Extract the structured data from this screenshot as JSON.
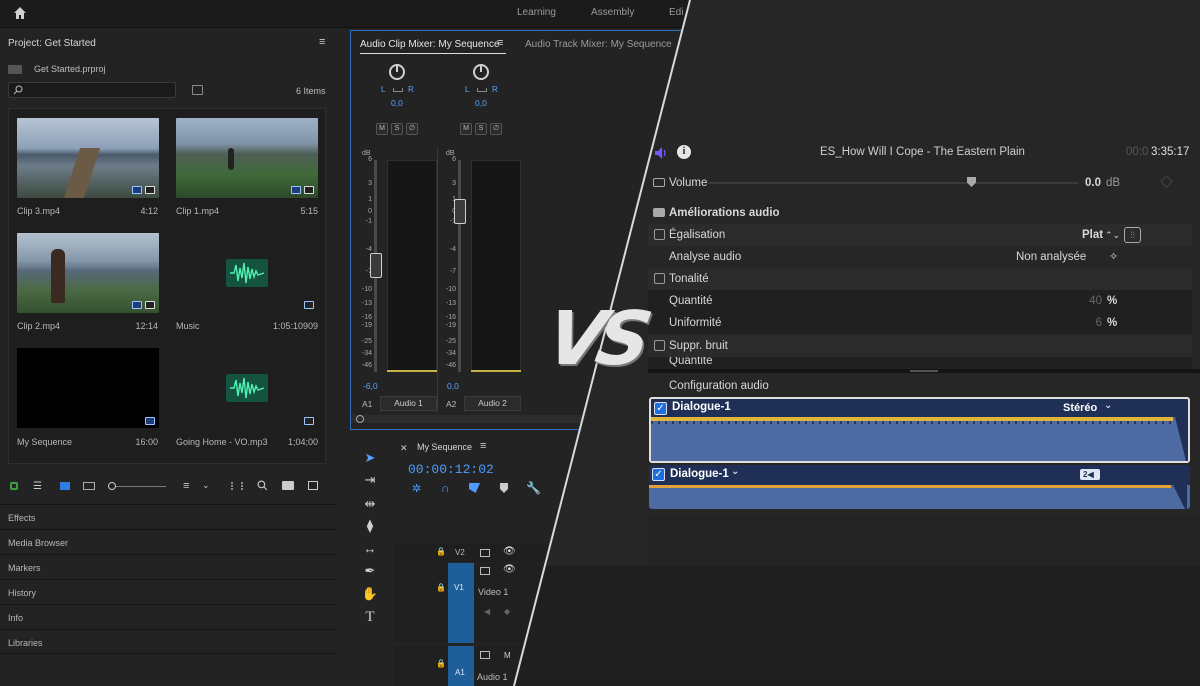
{
  "premiere": {
    "workspaces": [
      "Learning",
      "Assembly",
      "Edi"
    ],
    "project": {
      "title": "Project: Get Started",
      "file": "Get Started.prproj",
      "item_count": "6 Items",
      "search_placeholder": "",
      "items": [
        {
          "name": "Clip 3.mp4",
          "duration": "4:12",
          "kind": "video"
        },
        {
          "name": "Clip 1.mp4",
          "duration": "5:15",
          "kind": "video"
        },
        {
          "name": "Clip 2.mp4",
          "duration": "12:14",
          "kind": "video"
        },
        {
          "name": "Music",
          "duration": "1:05:10909",
          "kind": "audio"
        },
        {
          "name": "My Sequence",
          "duration": "16:00",
          "kind": "sequence"
        },
        {
          "name": "Going Home - VO.mp3",
          "duration": "1;04;00",
          "kind": "audio"
        }
      ]
    },
    "sections": [
      "Effects",
      "Media Browser",
      "Markers",
      "History",
      "Info",
      "Libraries"
    ],
    "mixer": {
      "tab_active": "Audio Clip Mixer: My Sequence",
      "tab_other": "Audio Track Mixer: My Sequence",
      "channels": [
        {
          "pan_l": "L",
          "pan_r": "R",
          "pan_value": "0,0",
          "fader_value": "-6,0",
          "track": "A1",
          "name": "Audio 1"
        },
        {
          "pan_l": "L",
          "pan_r": "R",
          "pan_value": "0,0",
          "fader_value": "0,0",
          "track": "A2",
          "name": "Audio 2"
        }
      ],
      "buttons": [
        "M",
        "S",
        "∅"
      ],
      "db_label": "dB",
      "db_scale": [
        "6",
        "3",
        "1",
        "0",
        "-1",
        "-4",
        "-7",
        "-10",
        "-13",
        "-16",
        "-19",
        "-25",
        "-34",
        "-46"
      ]
    },
    "timeline": {
      "sequence": "My Sequence",
      "timecode": "00:00:12:02",
      "tracks": [
        {
          "id": "V2",
          "name": ""
        },
        {
          "id": "V1",
          "name": "Video 1"
        },
        {
          "id": "A1",
          "name": "Audio 1"
        }
      ],
      "track_button_m": "M"
    }
  },
  "versus": "VS",
  "fcp": {
    "clip_title": "ES_How Will I Cope - The Eastern Plain",
    "timecode_dim": "00:0",
    "timecode": "3:35:17",
    "volume": {
      "label": "Volume",
      "value": "0.0",
      "unit": "dB"
    },
    "enhancements": {
      "title": "Améliorations audio",
      "equalization": {
        "label": "Égalisation",
        "value": "Plat"
      },
      "analysis": {
        "label": "Analyse audio",
        "value": "Non analysée"
      },
      "loudness": {
        "label": "Tonalité",
        "amount_label": "Quantité",
        "amount": "40",
        "uniformity_label": "Uniformité",
        "uniformity": "6",
        "unit": "%"
      },
      "noise": {
        "label": "Suppr. bruit",
        "amount_label": "Quantité"
      }
    },
    "config": {
      "title": "Configuration audio",
      "channels": [
        {
          "name": "Dialogue-1",
          "mode": "Stéréo"
        },
        {
          "name": "Dialogue-1",
          "badge": "2"
        }
      ]
    }
  }
}
